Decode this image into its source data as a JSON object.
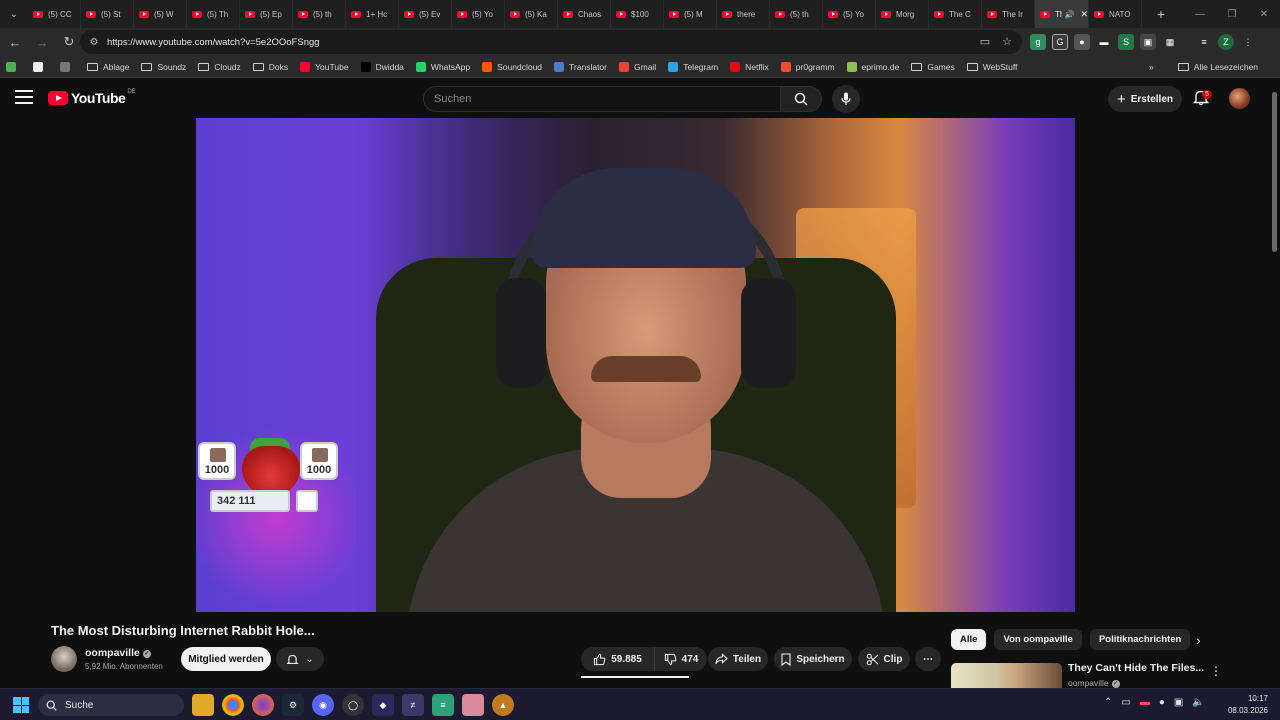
{
  "browser": {
    "tabs": [
      {
        "title": "(5) CC"
      },
      {
        "title": "(5) St"
      },
      {
        "title": "(5) W"
      },
      {
        "title": "(5) Th"
      },
      {
        "title": "(5) Ep"
      },
      {
        "title": "(5) th"
      },
      {
        "title": "1+ Hc"
      },
      {
        "title": "(5) Ev"
      },
      {
        "title": "(5) Yo"
      },
      {
        "title": "(5) Ka"
      },
      {
        "title": "Chaos"
      },
      {
        "title": "$100"
      },
      {
        "title": "(5) M"
      },
      {
        "title": "there"
      },
      {
        "title": "(5) th"
      },
      {
        "title": "(5) Yo"
      },
      {
        "title": "Morg"
      },
      {
        "title": "The C"
      },
      {
        "title": "The Ir"
      },
      {
        "title": "The In"
      },
      {
        "title": "NATO"
      }
    ],
    "active_tab_index": 19,
    "url": "https://www.youtube.com/watch?v=5e2OOoFSngg",
    "bookmarks": [
      {
        "label": "Ablage",
        "type": "folder"
      },
      {
        "label": "Soundz",
        "type": "folder"
      },
      {
        "label": "Cloudz",
        "type": "folder"
      },
      {
        "label": "Doks",
        "type": "folder"
      },
      {
        "label": "YouTube",
        "type": "site",
        "color": "#ff0033"
      },
      {
        "label": "Dwidda",
        "type": "site",
        "color": "#000000"
      },
      {
        "label": "WhatsApp",
        "type": "site",
        "color": "#25d366"
      },
      {
        "label": "Soundcloud",
        "type": "site",
        "color": "#ff5500"
      },
      {
        "label": "Translator",
        "type": "site",
        "color": "#4a7bd0"
      },
      {
        "label": "Gmail",
        "type": "site",
        "color": "#ea4335"
      },
      {
        "label": "Telegram",
        "type": "site",
        "color": "#2aa3e0"
      },
      {
        "label": "Netflix",
        "type": "site",
        "color": "#e50914"
      },
      {
        "label": "pr0gramm",
        "type": "site",
        "color": "#ee4d2e"
      },
      {
        "label": "eprimo.de",
        "type": "site",
        "color": "#8bc34a"
      },
      {
        "label": "Games",
        "type": "folder"
      },
      {
        "label": "WebStuff",
        "type": "folder"
      }
    ],
    "all_bookmarks_label": "Alle Lesezeichen"
  },
  "youtube": {
    "logo_text": "YouTube",
    "country_code": "DE",
    "search_placeholder": "Suchen",
    "create_label": "Erstellen",
    "notification_count": "5"
  },
  "video": {
    "title": "The Most Disturbing Internet Rabbit Hole...",
    "channel": "oompaville",
    "subscribers": "5,92 Mio. Abonnenten",
    "join_label": "Mitglied werden",
    "likes": "59.885",
    "dislikes": "474",
    "share_label": "Teilen",
    "save_label": "Speichern",
    "clip_label": "Clip",
    "overlay": {
      "tile_left": "1000",
      "tile_right": "1000",
      "score": "342 111"
    }
  },
  "sidebar": {
    "chips": [
      "Alle",
      "Von oompaville",
      "Politiknachrichten"
    ],
    "recommendation": {
      "title": "They Can't Hide The Files...",
      "channel": "oompaville"
    }
  },
  "taskbar": {
    "search_label": "Suche",
    "time": "10:17",
    "date": "08.03.2026"
  },
  "colors": {
    "yt_red": "#ff0033",
    "bg": "#0f0f0f",
    "chip_bg": "#272727"
  }
}
